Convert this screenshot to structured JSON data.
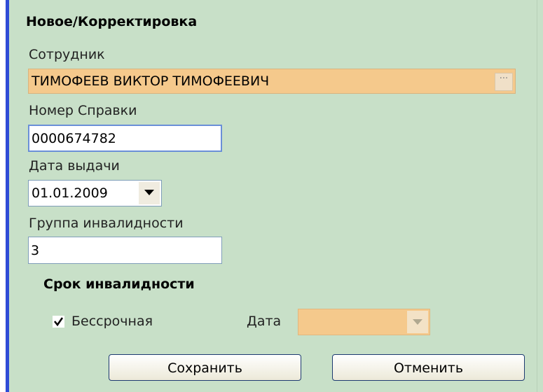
{
  "form": {
    "title": "Новое/Корректировка"
  },
  "employee": {
    "label": "Сотрудник",
    "value": "ТИМОФЕЕВ ВИКТОР ТИМОФЕЕВИЧ",
    "lookup_button": "···"
  },
  "certificate_number": {
    "label": "Номер Справки",
    "value": "0000674782"
  },
  "issue_date": {
    "label": "Дата выдачи",
    "value": "01.01.2009"
  },
  "disability_group": {
    "label": "Группа инвалидности",
    "value": "3"
  },
  "disability_term": {
    "title": "Срок инвалидности",
    "indefinite_label": "Бессрочная",
    "indefinite_checked": true,
    "date_label": "Дата",
    "date_value": ""
  },
  "buttons": {
    "save": "Сохранить",
    "cancel": "Отменить"
  },
  "colors": {
    "background": "#c8e0c8",
    "highlight_field": "#f5c98c",
    "accent_bar": "#2f4bd6",
    "input_border": "#6a8fd8"
  }
}
